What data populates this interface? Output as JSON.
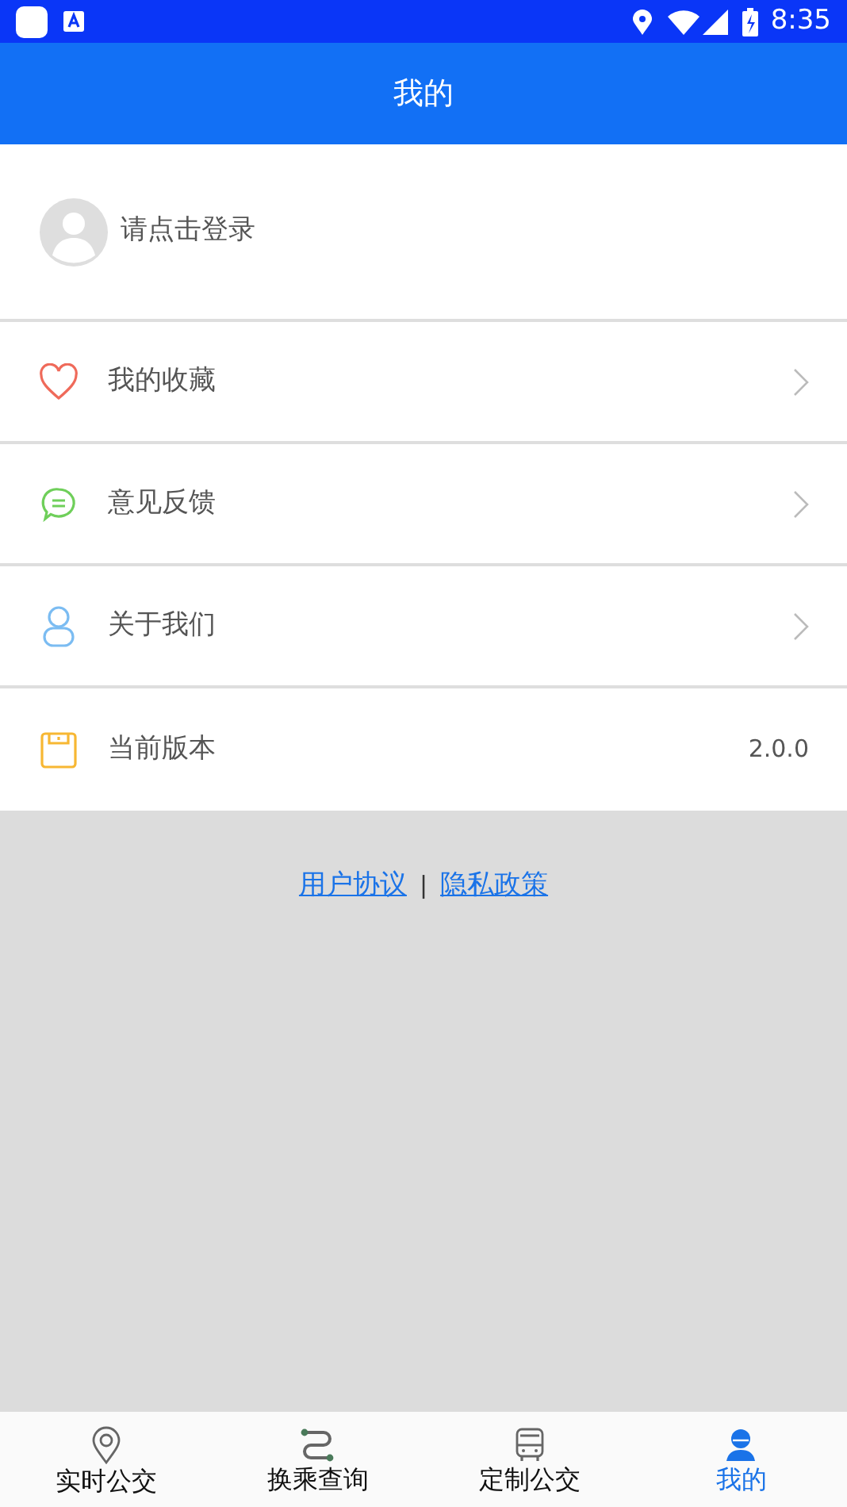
{
  "status_bar": {
    "time": "8:35"
  },
  "header": {
    "title": "我的"
  },
  "profile": {
    "login_prompt": "请点击登录"
  },
  "menu": [
    {
      "kind": "link",
      "label": "我的收藏"
    },
    {
      "kind": "link",
      "label": "意见反馈"
    },
    {
      "kind": "link",
      "label": "关于我们"
    },
    {
      "kind": "value",
      "label": "当前版本",
      "value": "2.0.0"
    }
  ],
  "footer_links": [
    "用户协议",
    "隐私政策"
  ],
  "footer_separator": "|",
  "tab_bar": [
    {
      "label": "实时公交",
      "selected": false
    },
    {
      "label": "换乘查询",
      "selected": false
    },
    {
      "label": "定制公交",
      "selected": false
    },
    {
      "label": "我的",
      "selected": true
    }
  ]
}
